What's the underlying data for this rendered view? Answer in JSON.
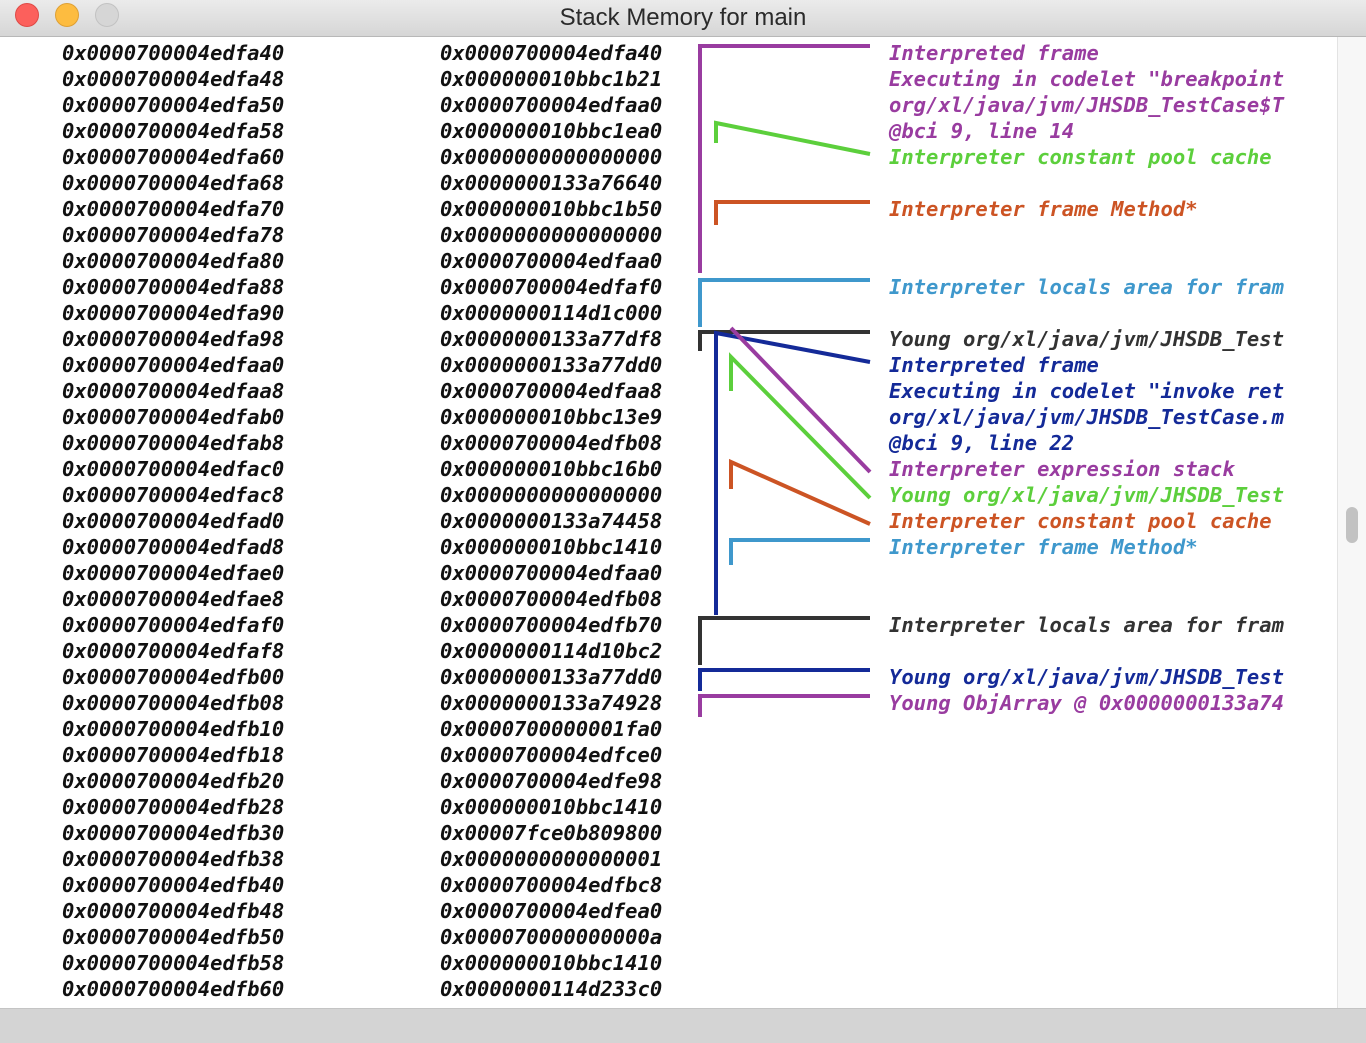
{
  "window": {
    "title": "Stack Memory for main"
  },
  "stack": {
    "rows": [
      {
        "address": "0x0000700004edfa40",
        "value": "0x0000700004edfa40"
      },
      {
        "address": "0x0000700004edfa48",
        "value": "0x000000010bbc1b21"
      },
      {
        "address": "0x0000700004edfa50",
        "value": "0x0000700004edfaa0"
      },
      {
        "address": "0x0000700004edfa58",
        "value": "0x000000010bbc1ea0"
      },
      {
        "address": "0x0000700004edfa60",
        "value": "0x0000000000000000"
      },
      {
        "address": "0x0000700004edfa68",
        "value": "0x0000000133a76640"
      },
      {
        "address": "0x0000700004edfa70",
        "value": "0x000000010bbc1b50"
      },
      {
        "address": "0x0000700004edfa78",
        "value": "0x0000000000000000"
      },
      {
        "address": "0x0000700004edfa80",
        "value": "0x0000700004edfaa0"
      },
      {
        "address": "0x0000700004edfa88",
        "value": "0x0000700004edfaf0"
      },
      {
        "address": "0x0000700004edfa90",
        "value": "0x0000000114d1c000"
      },
      {
        "address": "0x0000700004edfa98",
        "value": "0x0000000133a77df8"
      },
      {
        "address": "0x0000700004edfaa0",
        "value": "0x0000000133a77dd0"
      },
      {
        "address": "0x0000700004edfaa8",
        "value": "0x0000700004edfaa8"
      },
      {
        "address": "0x0000700004edfab0",
        "value": "0x000000010bbc13e9"
      },
      {
        "address": "0x0000700004edfab8",
        "value": "0x0000700004edfb08"
      },
      {
        "address": "0x0000700004edfac0",
        "value": "0x000000010bbc16b0"
      },
      {
        "address": "0x0000700004edfac8",
        "value": "0x0000000000000000"
      },
      {
        "address": "0x0000700004edfad0",
        "value": "0x0000000133a74458"
      },
      {
        "address": "0x0000700004edfad8",
        "value": "0x000000010bbc1410"
      },
      {
        "address": "0x0000700004edfae0",
        "value": "0x0000700004edfaa0"
      },
      {
        "address": "0x0000700004edfae8",
        "value": "0x0000700004edfb08"
      },
      {
        "address": "0x0000700004edfaf0",
        "value": "0x0000700004edfb70"
      },
      {
        "address": "0x0000700004edfaf8",
        "value": "0x0000000114d10bc2"
      },
      {
        "address": "0x0000700004edfb00",
        "value": "0x0000000133a77dd0"
      },
      {
        "address": "0x0000700004edfb08",
        "value": "0x0000000133a74928"
      },
      {
        "address": "0x0000700004edfb10",
        "value": "0x0000700000001fa0"
      },
      {
        "address": "0x0000700004edfb18",
        "value": "0x0000700004edfce0"
      },
      {
        "address": "0x0000700004edfb20",
        "value": "0x0000700004edfe98"
      },
      {
        "address": "0x0000700004edfb28",
        "value": "0x000000010bbc1410"
      },
      {
        "address": "0x0000700004edfb30",
        "value": "0x00007fce0b809800"
      },
      {
        "address": "0x0000700004edfb38",
        "value": "0x0000000000000001"
      },
      {
        "address": "0x0000700004edfb40",
        "value": "0x0000700004edfbc8"
      },
      {
        "address": "0x0000700004edfb48",
        "value": "0x0000700004edfea0"
      },
      {
        "address": "0x0000700004edfb50",
        "value": "0x000070000000000a"
      },
      {
        "address": "0x0000700004edfb58",
        "value": "0x000000010bbc1410"
      },
      {
        "address": "0x0000700004edfb60",
        "value": "0x0000000114d233c0"
      }
    ]
  },
  "colors": {
    "purple": "#993ca0",
    "green": "#5ccf3c",
    "orange": "#cc5424",
    "lightblue": "#3f98cc",
    "black": "#333333",
    "navy": "#142a98"
  },
  "annotations": [
    {
      "row": 0,
      "text": "Interpreted frame",
      "color": "#993ca0"
    },
    {
      "row": 1,
      "text": "Executing in codelet \"breakpoint",
      "color": "#993ca0"
    },
    {
      "row": 2,
      "text": "org/xl/java/jvm/JHSDB_TestCase$T",
      "color": "#993ca0"
    },
    {
      "row": 3,
      "text": "@bci 9, line 14",
      "color": "#993ca0"
    },
    {
      "row": 4,
      "text": "Interpreter constant pool cache",
      "color": "#5ccf3c"
    },
    {
      "row": 6,
      "text": "Interpreter frame Method*",
      "color": "#cc5424"
    },
    {
      "row": 9,
      "text": "Interpreter locals area for fram",
      "color": "#3f98cc"
    },
    {
      "row": 11,
      "text": "Young org/xl/java/jvm/JHSDB_Test",
      "color": "#333333"
    },
    {
      "row": 12,
      "text": "Interpreted frame",
      "color": "#142a98"
    },
    {
      "row": 13,
      "text": "Executing in codelet \"invoke ret",
      "color": "#142a98"
    },
    {
      "row": 14,
      "text": "org/xl/java/jvm/JHSDB_TestCase.m",
      "color": "#142a98"
    },
    {
      "row": 15,
      "text": "@bci 9, line 22",
      "color": "#142a98"
    },
    {
      "row": 16,
      "text": "Interpreter expression stack",
      "color": "#993ca0"
    },
    {
      "row": 17,
      "text": "Young org/xl/java/jvm/JHSDB_Test",
      "color": "#5ccf3c"
    },
    {
      "row": 18,
      "text": "Interpreter constant pool cache",
      "color": "#cc5424"
    },
    {
      "row": 19,
      "text": "Interpreter frame Method*",
      "color": "#3f98cc"
    },
    {
      "row": 22,
      "text": "Interpreter locals area for fram",
      "color": "#333333"
    },
    {
      "row": 24,
      "text": "Young org/xl/java/jvm/JHSDB_Test",
      "color": "#142a98"
    },
    {
      "row": 25,
      "text": "Young ObjArray @ 0x0000000133a74",
      "color": "#993ca0"
    }
  ]
}
